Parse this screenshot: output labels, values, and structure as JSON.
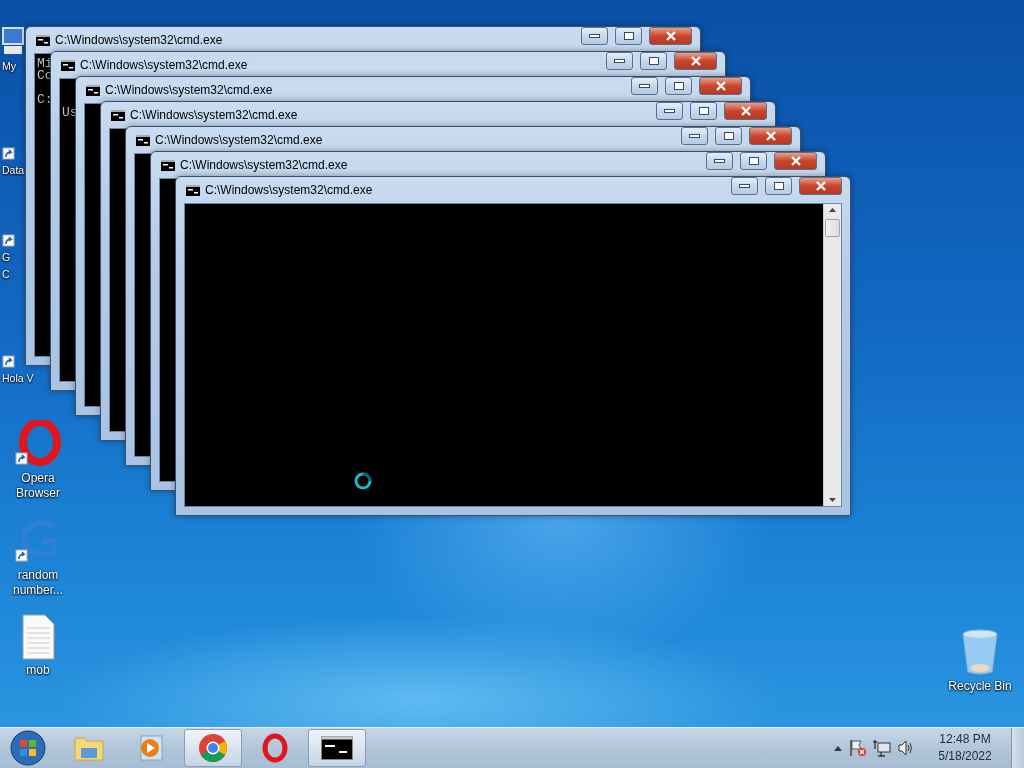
{
  "desktop": {
    "covered_icons": [
      {
        "kind": "computer",
        "lines": [
          "My"
        ]
      },
      {
        "kind": "shortcut",
        "lines": [
          "Data"
        ]
      },
      {
        "kind": "shortcut",
        "lines": [
          "G",
          "C"
        ]
      },
      {
        "kind": "shortcut",
        "lines": [
          "Hola V"
        ]
      }
    ],
    "icons": [
      {
        "kind": "opera",
        "label": "Opera Browser"
      },
      {
        "kind": "g-app",
        "label": "random number..."
      },
      {
        "kind": "document",
        "label": "mob"
      }
    ],
    "right_icons": [
      {
        "kind": "recycle-bin",
        "label": "Recycle Bin"
      }
    ]
  },
  "windows": [
    {
      "title": "C:\\Windows\\system32\\cmd.exe",
      "console_text": "Mi\nCo\n\nC:"
    },
    {
      "title": "C:\\Windows\\system32\\cmd.exe",
      "console_text": "\n\nUs"
    },
    {
      "title": "C:\\Windows\\system32\\cmd.exe"
    },
    {
      "title": "C:\\Windows\\system32\\cmd.exe"
    },
    {
      "title": "C:\\Windows\\system32\\cmd.exe"
    },
    {
      "title": "C:\\Windows\\system32\\cmd.exe"
    },
    {
      "title": "C:\\Windows\\system32\\cmd.exe"
    }
  ],
  "taskbar": {
    "items": [
      {
        "kind": "start",
        "running": false
      },
      {
        "kind": "folder",
        "running": false
      },
      {
        "kind": "media",
        "running": false
      },
      {
        "kind": "chrome",
        "running": true
      },
      {
        "kind": "opera",
        "running": false
      },
      {
        "kind": "console",
        "running": true
      }
    ],
    "tray": [
      {
        "kind": "arrow"
      },
      {
        "kind": "flag"
      },
      {
        "kind": "network"
      },
      {
        "kind": "volume"
      }
    ],
    "clock": {
      "time": "12:48 PM",
      "date": "5/18/2022"
    }
  }
}
